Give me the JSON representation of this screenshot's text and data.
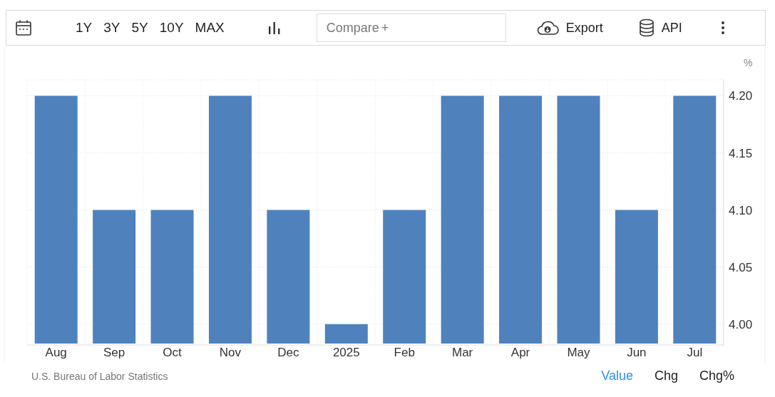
{
  "toolbar": {
    "ranges": [
      {
        "label": "1Y",
        "selected": false
      },
      {
        "label": "3Y",
        "selected": false
      },
      {
        "label": "5Y",
        "selected": false
      },
      {
        "label": "10Y",
        "selected": false
      },
      {
        "label": "MAX",
        "selected": false
      }
    ],
    "compare": {
      "placeholder": "Compare",
      "plus": "+"
    },
    "export": "Export",
    "api": "API"
  },
  "chart": {
    "unit": "%",
    "chart_data": {
      "type": "bar",
      "categories": [
        "Aug",
        "Sep",
        "Oct",
        "Nov",
        "Dec",
        "2025",
        "Feb",
        "Mar",
        "Apr",
        "May",
        "Jun",
        "Jul"
      ],
      "grid": true,
      "series": [
        {
          "color": "#4f81bd",
          "values": [
            4.2,
            4.1,
            4.1,
            4.2,
            4.1,
            4.0,
            4.1,
            4.2,
            4.2,
            4.2,
            4.1,
            4.2
          ]
        }
      ],
      "ylim": [
        3.983,
        4.214
      ],
      "yticks": [
        {
          "value": 4.0,
          "label": "4.00"
        },
        {
          "value": 4.05,
          "label": "4.05"
        },
        {
          "value": 4.1,
          "label": "4.10"
        },
        {
          "value": 4.15,
          "label": "4.15"
        },
        {
          "value": 4.2,
          "label": "4.20"
        }
      ]
    }
  },
  "footer": {
    "source": "U.S. Bureau of Labor Statistics",
    "modes": [
      {
        "label": "Value",
        "selected": true
      },
      {
        "label": "Chg",
        "selected": false
      },
      {
        "label": "Chg%",
        "selected": false
      }
    ]
  }
}
